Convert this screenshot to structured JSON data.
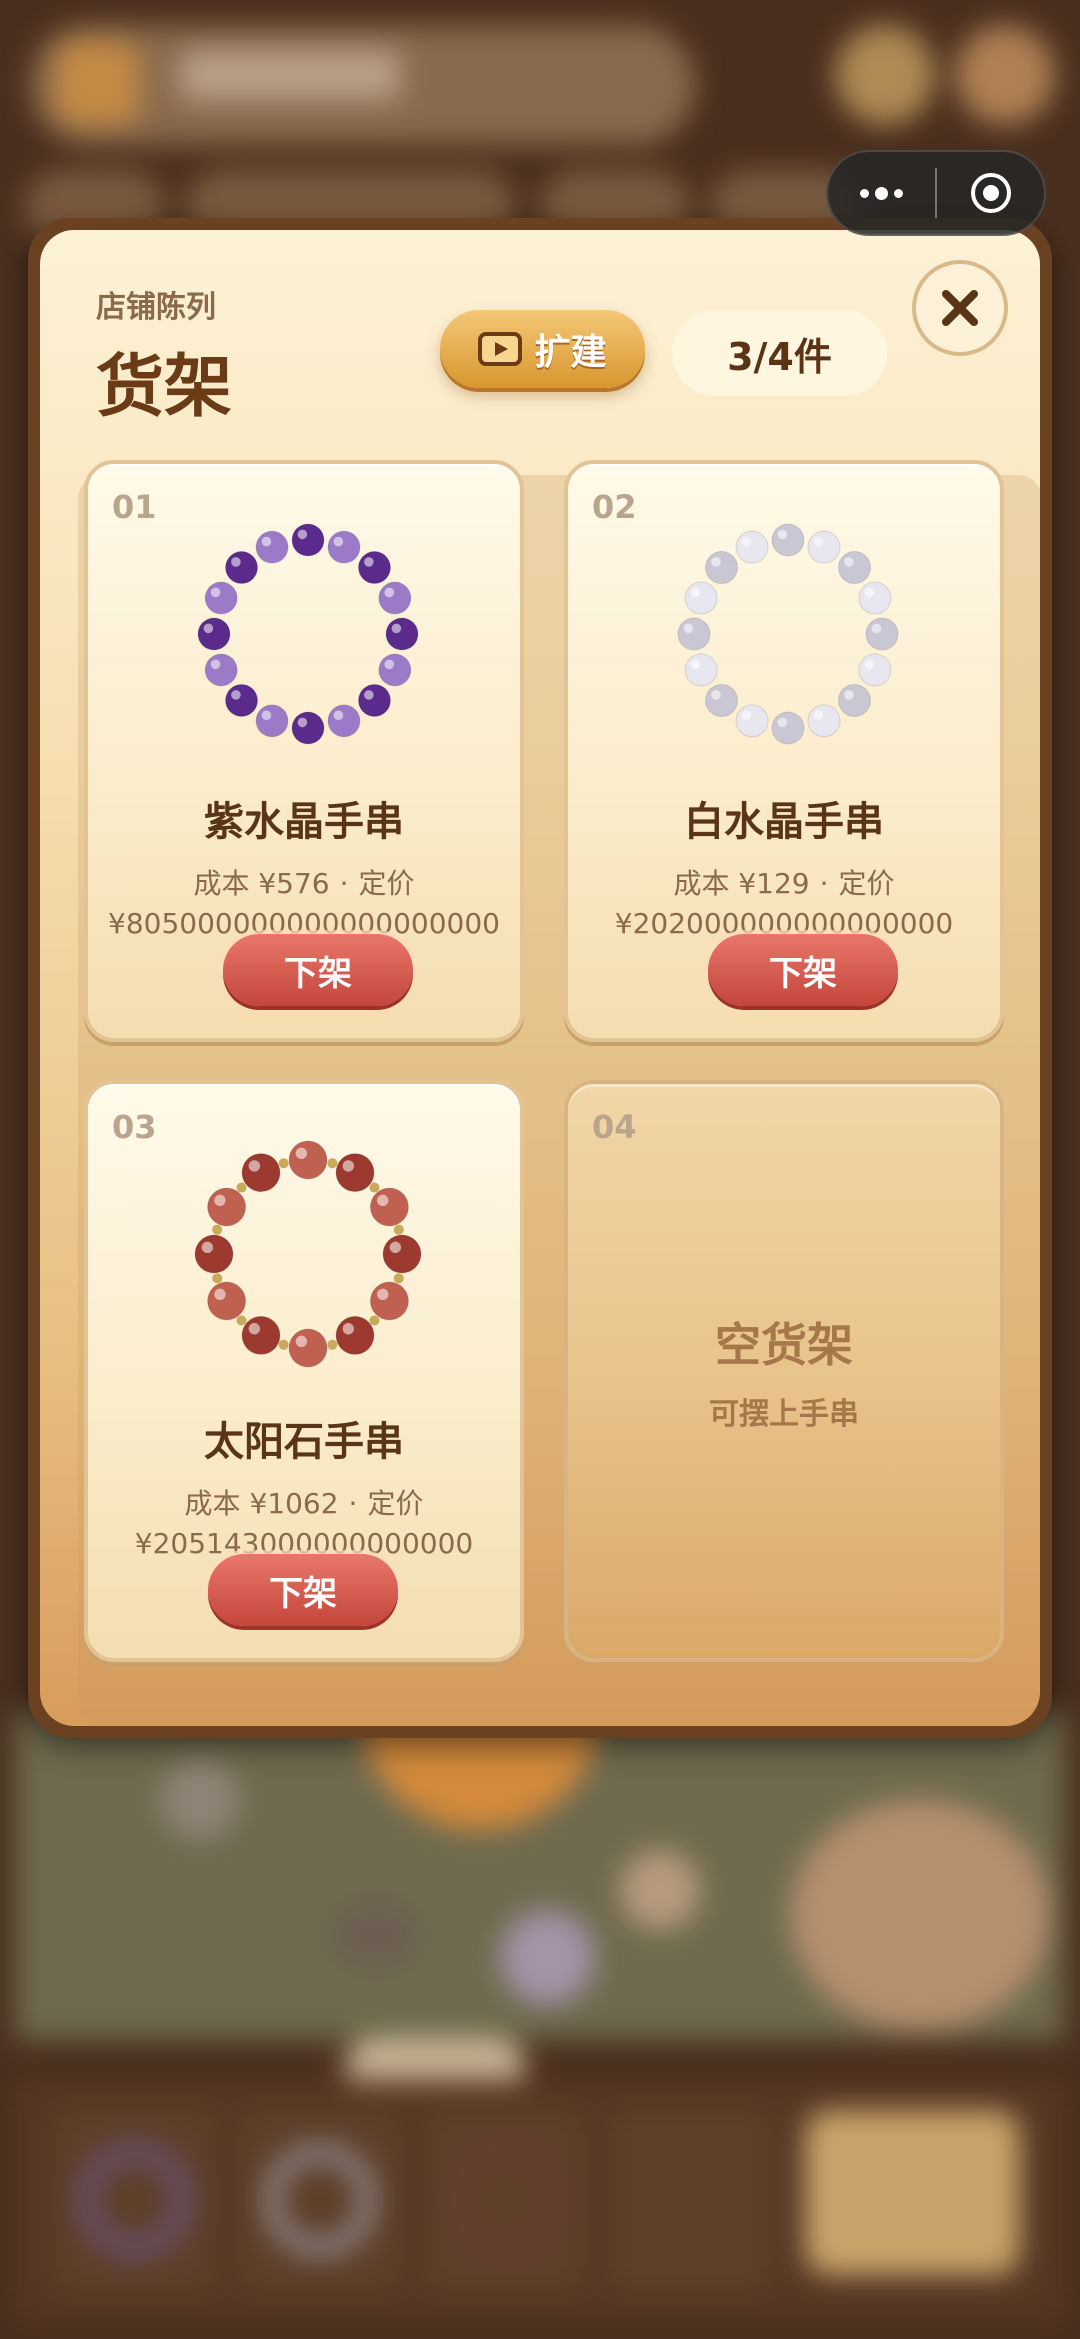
{
  "capsule": {
    "more_icon": "more-dots-icon",
    "close_icon": "target-circle-icon"
  },
  "panel": {
    "subtitle": "店铺陈列",
    "title": "货架",
    "expand_label": "扩建",
    "expand_icon": "play-video-icon",
    "count": "3/4件",
    "close_icon": "close-x-icon"
  },
  "shelves": [
    {
      "number": "01",
      "name": "紫水晶手串",
      "cost_text": "成本 ¥576",
      "price_label": "定价",
      "price": "¥805000000000000000000",
      "action": "下架",
      "beads": [
        "#5a2a8c",
        "#9b7bc8"
      ]
    },
    {
      "number": "02",
      "name": "白水晶手串",
      "cost_text": "成本 ¥129",
      "price_label": "定价",
      "price": "¥202000000000000000",
      "action": "下架",
      "beads": [
        "#c9c7d4",
        "#e8e7ef"
      ]
    },
    {
      "number": "03",
      "name": "太阳石手串",
      "cost_text": "成本 ¥1062",
      "price_label": "定价",
      "price": "¥205143000000000000",
      "action": "下架",
      "beads": [
        "#9c3a30",
        "#c06050"
      ]
    },
    {
      "number": "04",
      "empty_title": "空货架",
      "empty_subtitle": "可摆上手串"
    }
  ],
  "colors": {
    "panel_border": "#6b4221",
    "accent_gold": "#d9962f",
    "action_red": "#c4463b",
    "text_brown": "#5a3416"
  }
}
